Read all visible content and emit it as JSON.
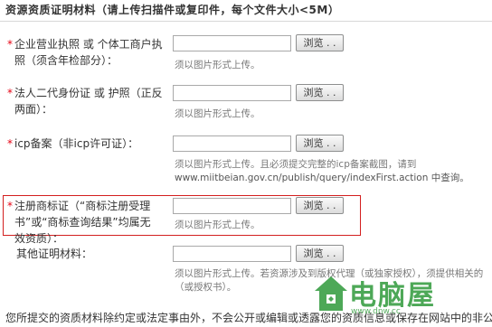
{
  "section": {
    "title": "资源资质证明材料（请上传扫描件或复印件，每个文件大小<5M）"
  },
  "fields": [
    {
      "required": "*",
      "label_line1": "企业营业执照 或 个体工商户执",
      "label_line2": "照（须含年检部分）：",
      "browse_label": "浏览 . .",
      "hint": "须以图片形式上传。"
    },
    {
      "required": "*",
      "label_line1": "法人二代身份证 或 护照（正反",
      "label_line2": "两面）：",
      "browse_label": "浏览 . .",
      "hint": "须以图片形式上传。"
    },
    {
      "required": "*",
      "label_line1": "icp备案（非icp许可证）：",
      "browse_label": "浏览 . .",
      "hint": "须以图片形式上传。且必须提交完整的icp备案截图，请到",
      "hint_link": "www.miitbeian.gov.cn/publish/query/indexFirst.action 中查询。"
    },
    {
      "required": "*",
      "label_line1": "注册商标证（“商标注册受理",
      "label_line2": "书”或“商标查询结果”均属无",
      "label_line3": "效资质）：",
      "browse_label": "浏览 . .",
      "hint": "须以图片形式上传。"
    },
    {
      "label_line1": "其他证明材料：",
      "browse_label": "浏览 . .",
      "hint": "须以图片形式上传。若资源涉及到版权代理（或独家授权），须提供相关的",
      "hint_line2": "（或授权书）。"
    }
  ],
  "footer": {
    "note": "您所提交的资质材料除约定或法定事由外，不会公开或编辑或透露您的资质信息或保存在网站中的非公开内容。"
  },
  "watermark": {
    "text": "电脑屋",
    "sub": "www.dnw.cc"
  },
  "colors": {
    "required": "#e60012",
    "highlight": "#d31f1f",
    "watermark": "#2f9a3a"
  }
}
